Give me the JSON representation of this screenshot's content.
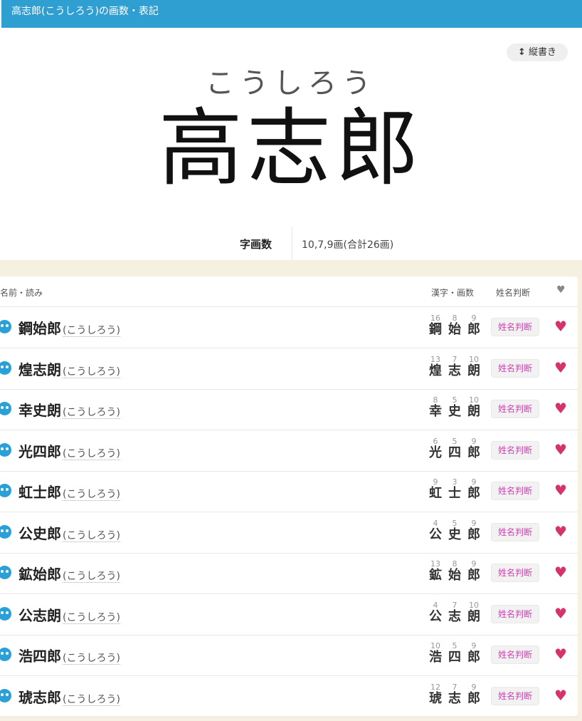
{
  "header": {
    "title": "高志郎(こうしろう)の画数・表記"
  },
  "vertical_button": {
    "arrow": "↕",
    "label": "縦書き"
  },
  "hero": {
    "reading": "こうしろう",
    "name": "高志郎"
  },
  "strokes": {
    "label": "字画数",
    "value": "10,7,9画(合計26画)"
  },
  "list": {
    "headers": {
      "name": "名前・読み",
      "kanji": "漢字・画数",
      "judge": "姓名判断",
      "heart": "♥"
    },
    "rows": [
      {
        "name": "鋼始郎",
        "yomi": "(こうしろう)",
        "chars": [
          "鋼",
          "始",
          "郎"
        ],
        "nums": [
          "16",
          "8",
          "9"
        ],
        "judge": "姓名判断"
      },
      {
        "name": "煌志朗",
        "yomi": "(こうしろう)",
        "chars": [
          "煌",
          "志",
          "朗"
        ],
        "nums": [
          "13",
          "7",
          "10"
        ],
        "judge": "姓名判断"
      },
      {
        "name": "幸史朗",
        "yomi": "(こうしろう)",
        "chars": [
          "幸",
          "史",
          "朗"
        ],
        "nums": [
          "8",
          "5",
          "10"
        ],
        "judge": "姓名判断"
      },
      {
        "name": "光四郎",
        "yomi": "(こうしろう)",
        "chars": [
          "光",
          "四",
          "郎"
        ],
        "nums": [
          "6",
          "5",
          "9"
        ],
        "judge": "姓名判断"
      },
      {
        "name": "虹士郎",
        "yomi": "(こうしろう)",
        "chars": [
          "虹",
          "士",
          "郎"
        ],
        "nums": [
          "9",
          "3",
          "9"
        ],
        "judge": "姓名判断"
      },
      {
        "name": "公史郎",
        "yomi": "(こうしろう)",
        "chars": [
          "公",
          "史",
          "郎"
        ],
        "nums": [
          "4",
          "5",
          "9"
        ],
        "judge": "姓名判断"
      },
      {
        "name": "鉱始郎",
        "yomi": "(こうしろう)",
        "chars": [
          "鉱",
          "始",
          "郎"
        ],
        "nums": [
          "13",
          "8",
          "9"
        ],
        "judge": "姓名判断"
      },
      {
        "name": "公志朗",
        "yomi": "(こうしろう)",
        "chars": [
          "公",
          "志",
          "朗"
        ],
        "nums": [
          "4",
          "7",
          "10"
        ],
        "judge": "姓名判断"
      },
      {
        "name": "浩四郎",
        "yomi": "(こうしろう)",
        "chars": [
          "浩",
          "四",
          "郎"
        ],
        "nums": [
          "10",
          "5",
          "9"
        ],
        "judge": "姓名判断"
      },
      {
        "name": "琥志郎",
        "yomi": "(こうしろう)",
        "chars": [
          "琥",
          "志",
          "郎"
        ],
        "nums": [
          "12",
          "7",
          "9"
        ],
        "judge": "姓名判断"
      }
    ]
  },
  "colors": {
    "header_bar": "#2e9fd0",
    "heart": "#d6336c",
    "judge_text": "#d63db5",
    "face_icon": "#2aa0d8"
  }
}
